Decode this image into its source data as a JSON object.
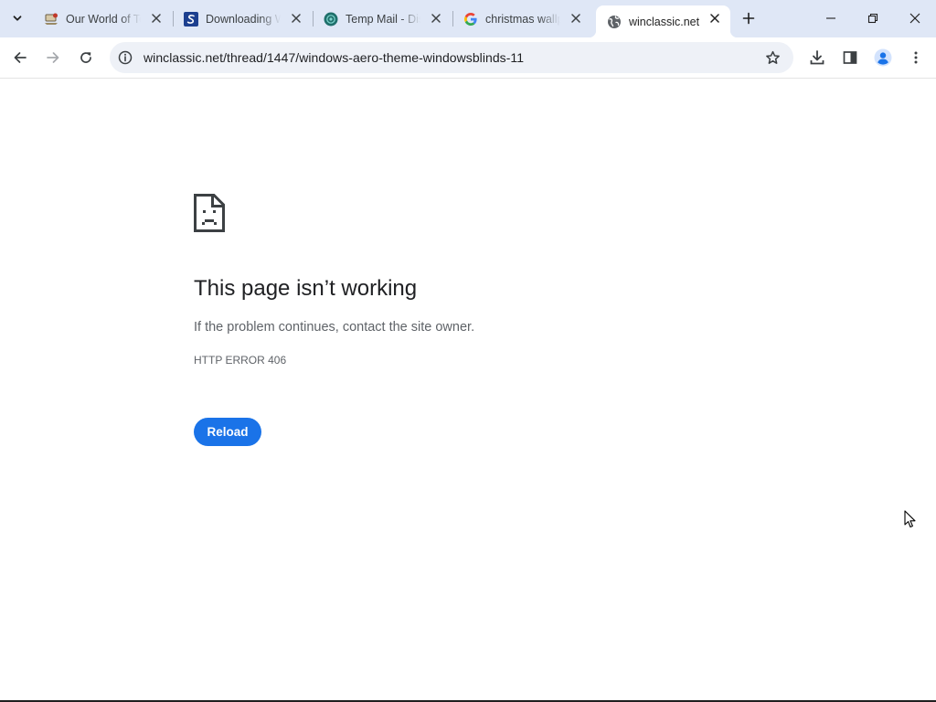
{
  "browser": {
    "tabs": [
      {
        "title": "Our World of Technology",
        "favicon": "laptop-favicon",
        "active": false
      },
      {
        "title": "Downloading Windows",
        "favicon": "blue-s-favicon",
        "active": false
      },
      {
        "title": "Temp Mail - Disposable",
        "favicon": "tempmail-favicon",
        "active": false
      },
      {
        "title": "christmas wallpaper",
        "favicon": "google-g-favicon",
        "active": false
      },
      {
        "title": "winclassic.net",
        "favicon": "globe-favicon",
        "active": true
      }
    ],
    "address_bar": {
      "url": "winclassic.net/thread/1447/windows-aero-theme-windowsblinds-11"
    }
  },
  "error_page": {
    "heading": "This page isn’t working",
    "description": "If the problem continues, contact the site owner.",
    "error_code": "HTTP ERROR 406",
    "reload_label": "Reload"
  },
  "colors": {
    "tabstrip_bg": "#dfe7f6",
    "omnibox_bg": "#eef1f7",
    "reload_button": "#1a73e8",
    "heading_text": "#202124",
    "secondary_text": "#5f6368"
  }
}
